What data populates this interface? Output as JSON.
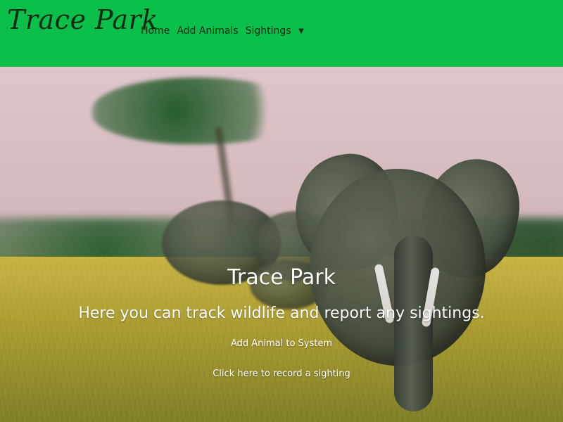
{
  "navbar": {
    "brand": "Trace Park",
    "items": [
      {
        "label": "Home"
      },
      {
        "label": "Add Animals"
      },
      {
        "label": "Sightings"
      }
    ]
  },
  "hero": {
    "title": "Trace Park",
    "subtitle": "Here you can track wildlife and report any sightings.",
    "links": [
      {
        "label": "Add Animal to System"
      },
      {
        "label": "Click here to record a sighting"
      }
    ]
  },
  "icons": {
    "dropdown": "caret-down-icon"
  },
  "colors": {
    "navbar_bg": "#0bbf4b",
    "nav_text": "#0a2a12",
    "hero_text": "#ffffff"
  }
}
